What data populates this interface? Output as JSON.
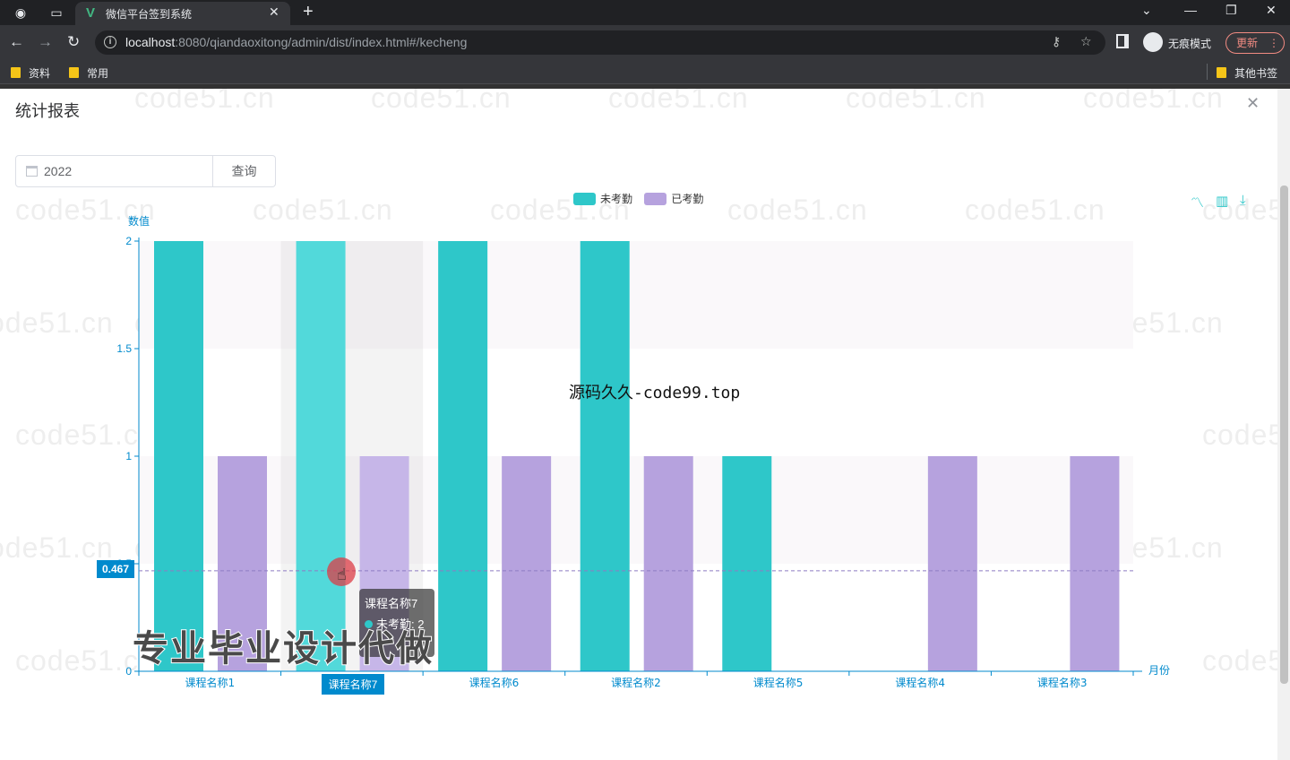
{
  "browser": {
    "tab_title": "微信平台签到系统",
    "url_host": "localhost",
    "url_rest": ":8080/qiandaoxitong/admin/dist/index.html#/kecheng",
    "incognito_label": "无痕模式",
    "update_label": "更新",
    "bookmarks": [
      "资料",
      "常用"
    ],
    "other_bookmarks": "其他书签"
  },
  "dialog": {
    "title": "统计报表",
    "year_value": "2022",
    "query_label": "查询"
  },
  "watermark_text": "code51.cn",
  "overlays": {
    "promo": "专业毕业设计代做",
    "site": "源码久久-code99.top"
  },
  "chart_data": {
    "type": "bar",
    "ylabel": "数值",
    "xlabel": "月份",
    "ylim": [
      0,
      2
    ],
    "yticks": [
      "0",
      "0.5",
      "1",
      "1.5",
      "2"
    ],
    "categories": [
      "课程名称1",
      "课程名称7",
      "课程名称6",
      "课程名称2",
      "课程名称5",
      "课程名称4",
      "课程名称3"
    ],
    "series": [
      {
        "name": "未考勤",
        "color": "#2ec7c9",
        "values": [
          2,
          2,
          2,
          2,
          1,
          0,
          0
        ]
      },
      {
        "name": "已考勤",
        "color": "#b6a2de",
        "values": [
          1,
          1,
          1,
          1,
          0,
          1,
          1
        ]
      }
    ],
    "legend": "top-center",
    "crosshair_y_value": "0.467",
    "highlighted_category": "课程名称7",
    "tooltip": {
      "title": "课程名称7",
      "series": "未考勤",
      "value": "2"
    }
  },
  "colors": {
    "axis": "#008acd",
    "bar1": "#2ec7c9",
    "bar2": "#b6a2de"
  }
}
